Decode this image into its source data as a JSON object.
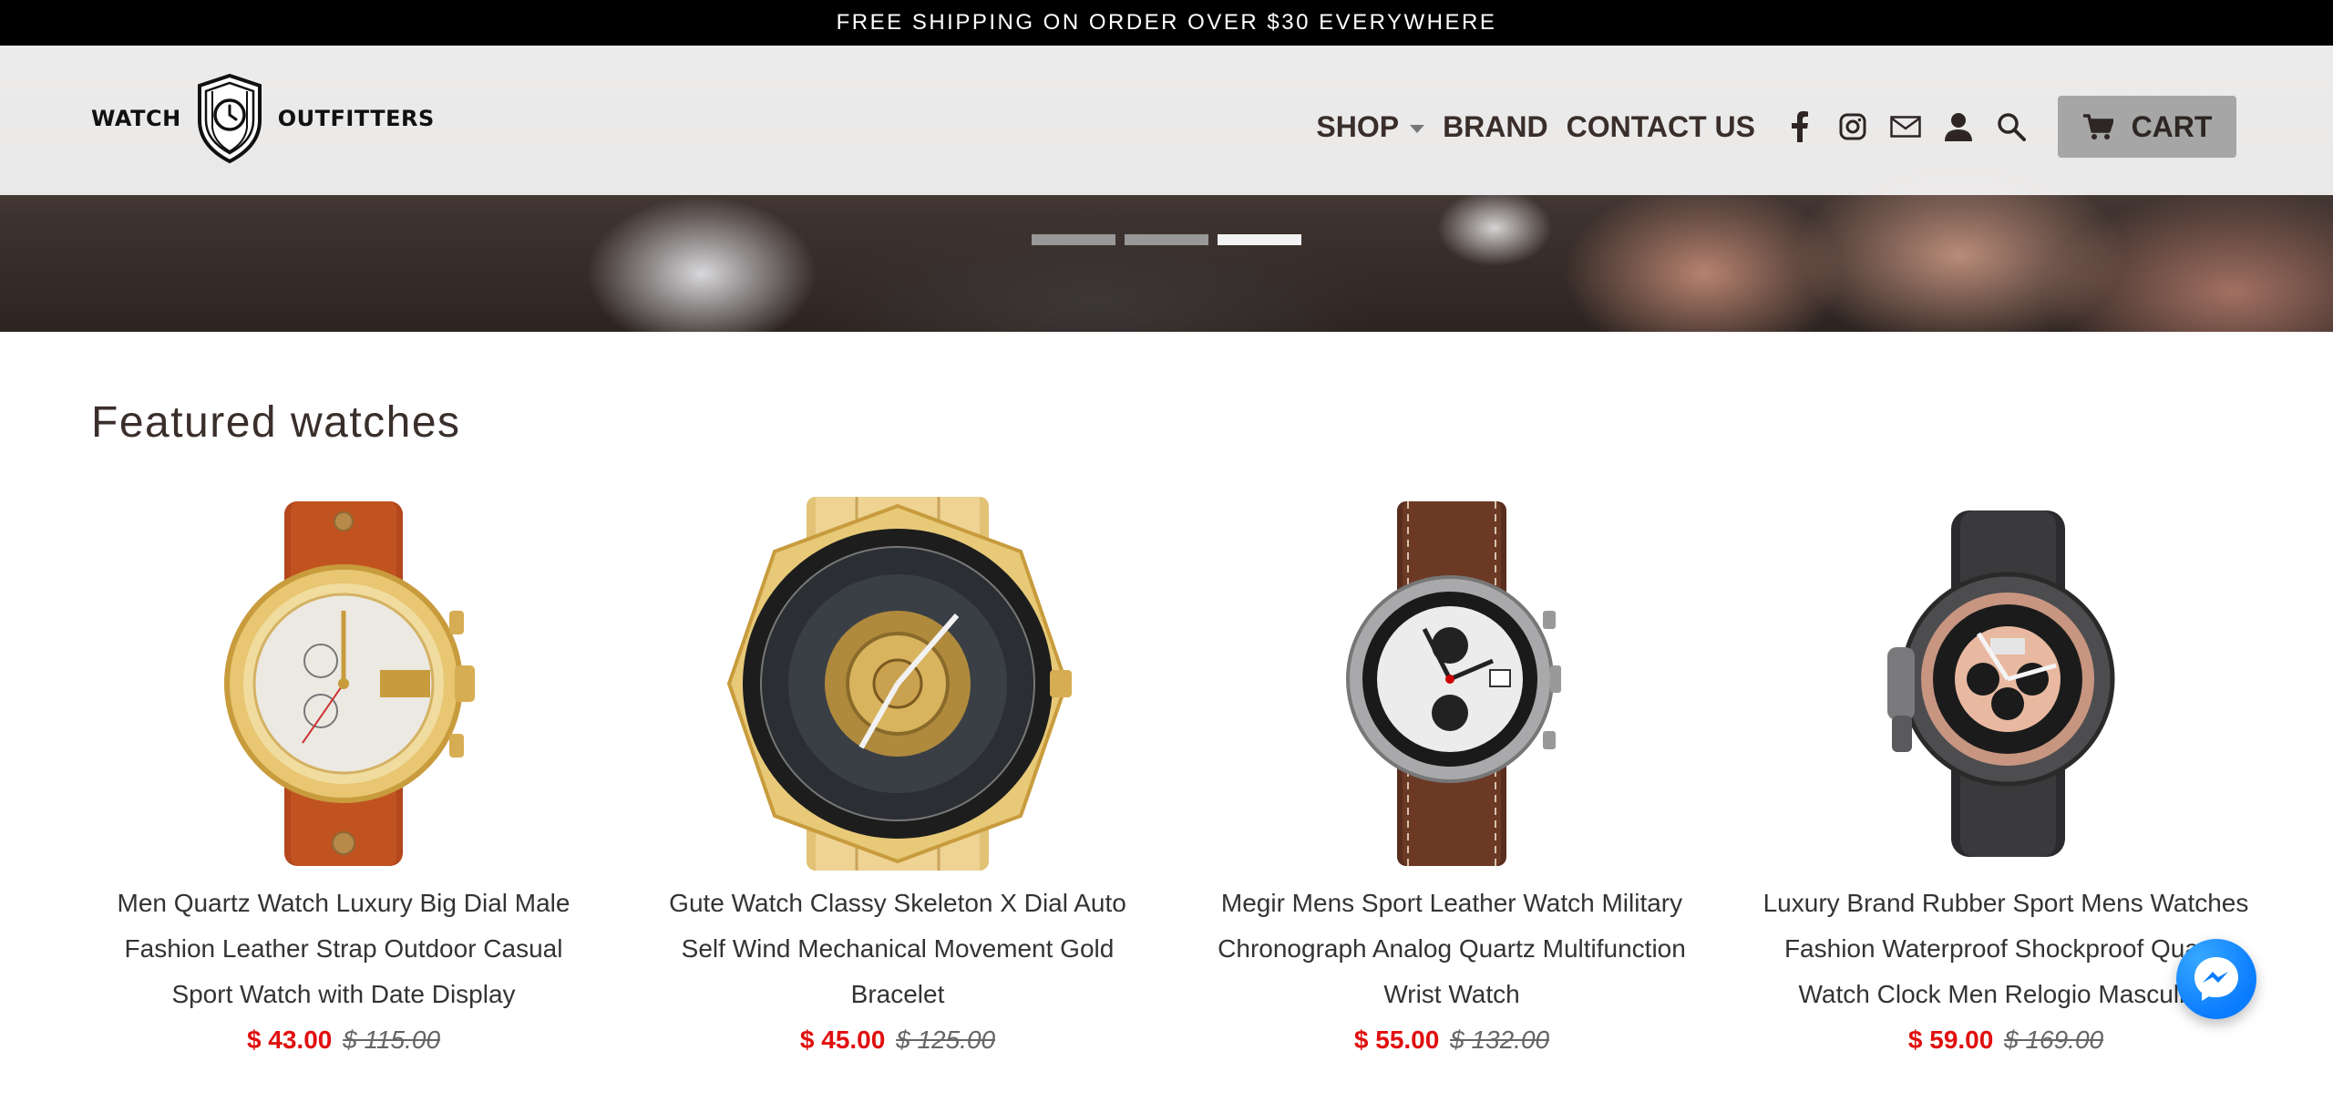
{
  "announcement": "FREE SHIPPING ON ORDER OVER $30 EVERYWHERE",
  "logo": {
    "left_text": "WATCH",
    "right_text": "OUTFITTERS"
  },
  "nav": {
    "shop": "SHOP",
    "brand": "BRAND",
    "contact": "CONTACT US",
    "cart": "CART"
  },
  "icons": [
    "facebook-icon",
    "instagram-icon",
    "mail-icon",
    "account-icon",
    "search-icon",
    "cart-icon",
    "messenger-icon",
    "chevron-down-icon"
  ],
  "slider": {
    "slides": 3,
    "active_index": 2
  },
  "featured": {
    "title": "Featured watches",
    "products": [
      {
        "title": "Men Quartz Watch Luxury Big Dial Male Fashion Leather Strap Outdoor Casual Sport Watch with Date Display",
        "price": "$ 43.00",
        "compare_price": "$ 115.00"
      },
      {
        "title": "Gute Watch Classy Skeleton X Dial Auto Self Wind Mechanical Movement Gold Bracelet",
        "price": "$ 45.00",
        "compare_price": "$ 125.00"
      },
      {
        "title": "Megir Mens Sport Leather Watch Military Chronograph Analog Quartz Multifunction Wrist Watch",
        "price": "$ 55.00",
        "compare_price": "$ 132.00"
      },
      {
        "title": "Luxury Brand Rubber Sport Mens Watches Fashion Waterproof Shockproof Quartz Watch Clock Men Relogio Masculino",
        "price": "$ 59.00",
        "compare_price": "$ 169.00"
      }
    ]
  },
  "colors": {
    "sale_price": "#e10f0f",
    "text": "#3a2e2b",
    "cart_button": "#a6a6a6",
    "messenger": "#0a7cff"
  }
}
